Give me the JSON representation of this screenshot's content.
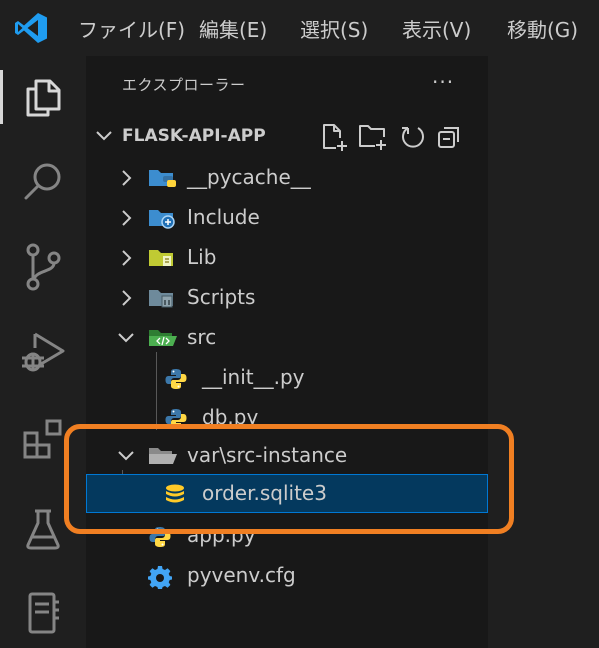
{
  "menu": {
    "items": [
      {
        "label": "ファイル(F)"
      },
      {
        "label": "編集(E)"
      },
      {
        "label": "選択(S)"
      },
      {
        "label": "表示(V)"
      },
      {
        "label": "移動(G)"
      }
    ]
  },
  "activity": {
    "items": [
      "explorer",
      "search",
      "source-control",
      "run-and-debug",
      "extensions",
      "testing",
      "notebook"
    ]
  },
  "explorer": {
    "title": "エクスプローラー",
    "more": "···",
    "project": "FLASK-API-APP",
    "tree": [
      {
        "name": "__pycache__",
        "type": "folder",
        "expanded": false
      },
      {
        "name": "Include",
        "type": "folder",
        "expanded": false
      },
      {
        "name": "Lib",
        "type": "folder",
        "expanded": false
      },
      {
        "name": "Scripts",
        "type": "folder",
        "expanded": false
      },
      {
        "name": "src",
        "type": "folder",
        "expanded": true
      },
      {
        "name": "__init__.py",
        "type": "python"
      },
      {
        "name": "db.py",
        "type": "python"
      },
      {
        "name": "var\\src-instance",
        "type": "folder",
        "expanded": true
      },
      {
        "name": "order.sqlite3",
        "type": "database",
        "selected": true
      },
      {
        "name": "app.py",
        "type": "python"
      },
      {
        "name": "pyvenv.cfg",
        "type": "config"
      }
    ]
  },
  "colors": {
    "accent": "#0078d4",
    "highlight": "#f07f22",
    "selection": "#04395e"
  }
}
